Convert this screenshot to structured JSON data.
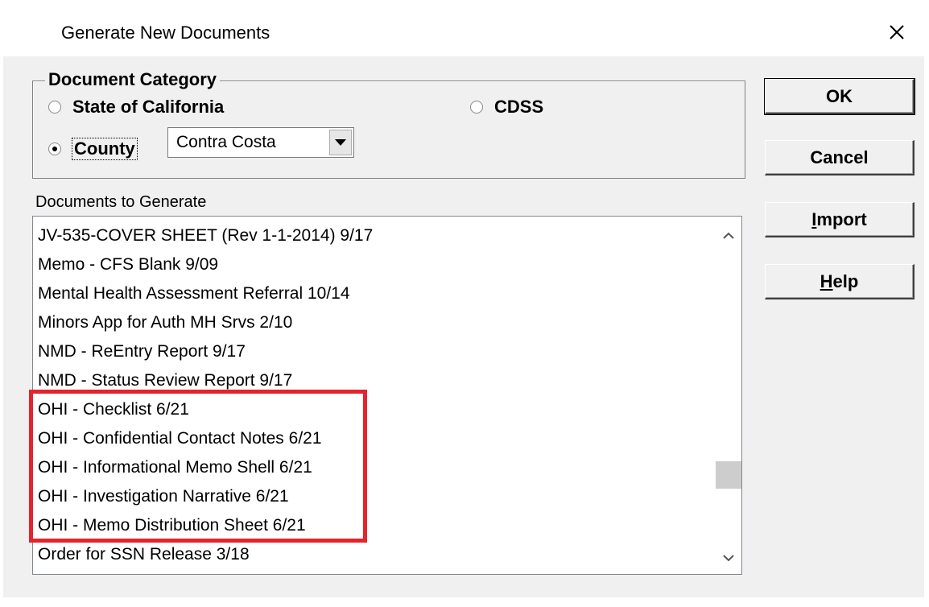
{
  "window": {
    "title": "Generate New Documents",
    "close_icon": "close-icon"
  },
  "document_category": {
    "legend": "Document Category",
    "options": [
      {
        "label": "State of California",
        "selected": false
      },
      {
        "label": "CDSS",
        "selected": false
      },
      {
        "label": "County",
        "selected": true
      }
    ],
    "county_select": {
      "value": "Contra Costa"
    }
  },
  "documents": {
    "label": "Documents to Generate",
    "items": [
      "JV-535-COVER SHEET  (Rev 1-1-2014)  9/17",
      "Memo - CFS Blank 9/09",
      "Mental Health Assessment Referral 10/14",
      "Minors App for Auth MH Srvs 2/10",
      "NMD - ReEntry Report  9/17",
      "NMD - Status Review Report  9/17",
      "OHI - Checklist  6/21",
      "OHI - Confidential Contact Notes  6/21",
      "OHI - Informational Memo Shell  6/21",
      "OHI - Investigation Narrative  6/21",
      "OHI - Memo Distribution Sheet  6/21",
      "Order for SSN Release  3/18"
    ]
  },
  "buttons": {
    "ok": "OK",
    "cancel": "Cancel",
    "import_first": "I",
    "import_rest": "mport",
    "help_first": "H",
    "help_rest": "elp"
  },
  "colors": {
    "highlight": "#e4232c",
    "dialog_bg": "#f0f0f0"
  }
}
